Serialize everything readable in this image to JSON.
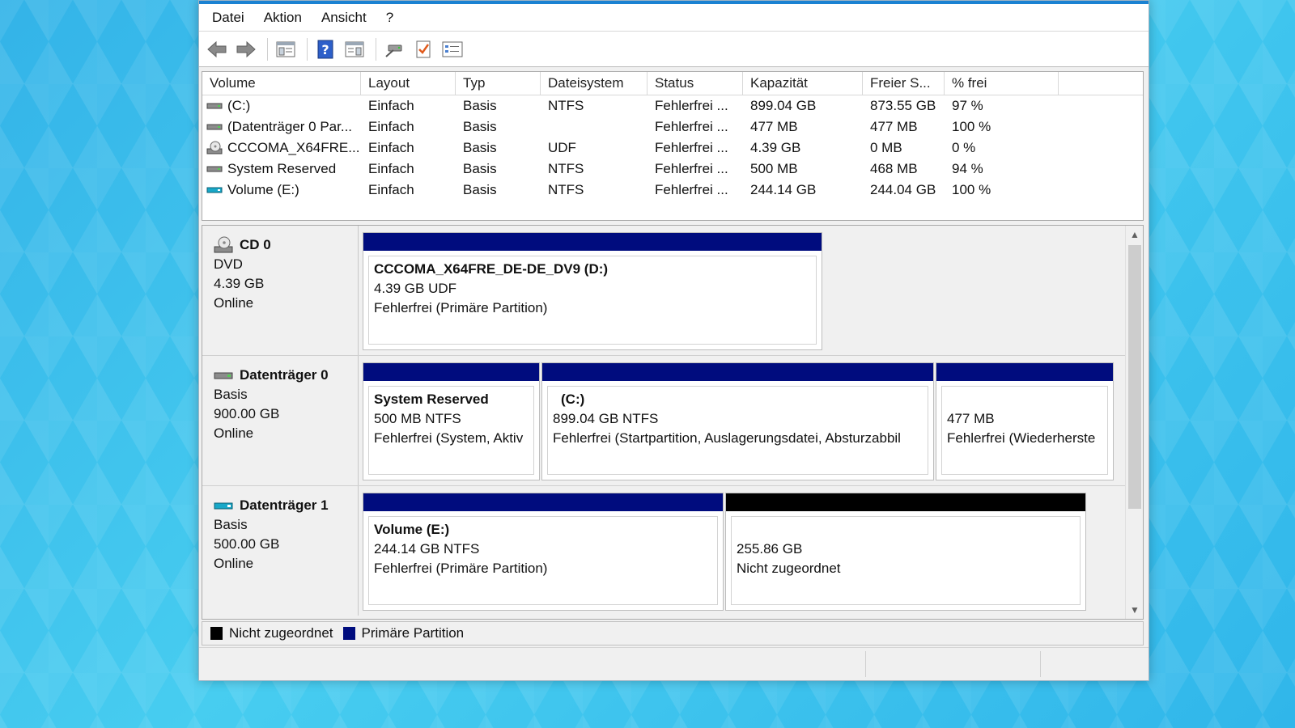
{
  "menu": [
    "Datei",
    "Aktion",
    "Ansicht",
    "?"
  ],
  "toolbar": {
    "icons": [
      "back-arrow-icon",
      "forward-arrow-icon",
      "console-tree-icon",
      "help-icon",
      "action-pane-icon",
      "connect-disk-icon",
      "check-properties-icon",
      "list-view-icon"
    ]
  },
  "volume_list": {
    "columns": [
      "Volume",
      "Layout",
      "Typ",
      "Dateisystem",
      "Status",
      "Kapazität",
      "Freier S...",
      "% frei"
    ],
    "rows": [
      {
        "volume": "(C:)",
        "icon": "drive-icon",
        "layout": "Einfach",
        "typ": "Basis",
        "fs": "NTFS",
        "status": "Fehlerfrei ...",
        "cap": "899.04 GB",
        "free": "873.55 GB",
        "pct": "97 %"
      },
      {
        "volume": "(Datenträger 0 Par...",
        "icon": "drive-icon",
        "layout": "Einfach",
        "typ": "Basis",
        "fs": "",
        "status": "Fehlerfrei ...",
        "cap": "477 MB",
        "free": "477 MB",
        "pct": "100 %"
      },
      {
        "volume": "CCCOMA_X64FRE...",
        "icon": "dvd-icon",
        "layout": "Einfach",
        "typ": "Basis",
        "fs": "UDF",
        "status": "Fehlerfrei ...",
        "cap": "4.39 GB",
        "free": "0 MB",
        "pct": "0 %"
      },
      {
        "volume": "System Reserved",
        "icon": "drive-icon",
        "layout": "Einfach",
        "typ": "Basis",
        "fs": "NTFS",
        "status": "Fehlerfrei ...",
        "cap": "500 MB",
        "free": "468 MB",
        "pct": "94 %"
      },
      {
        "volume": "Volume (E:)",
        "icon": "usb-drive-icon",
        "layout": "Einfach",
        "typ": "Basis",
        "fs": "NTFS",
        "status": "Fehlerfrei ...",
        "cap": "244.14 GB",
        "free": "244.04 GB",
        "pct": "100 %"
      }
    ]
  },
  "disks": [
    {
      "name": "CD 0",
      "type": "DVD",
      "size": "4.39 GB",
      "state": "Online",
      "icon": "dvd-icon",
      "partitions": [
        {
          "title": "CCCOMA_X64FRE_DE-DE_DV9  (D:)",
          "line2": "4.39 GB UDF",
          "line3": "Fehlerfrei (Primäre Partition)",
          "kind": "primary"
        }
      ]
    },
    {
      "name": "Datenträger 0",
      "type": "Basis",
      "size": "900.00 GB",
      "state": "Online",
      "icon": "drive-icon",
      "partitions": [
        {
          "title": "System Reserved",
          "line2": "500 MB NTFS",
          "line3": "Fehlerfrei (System, Aktiv",
          "kind": "primary"
        },
        {
          "title": "(C:)",
          "line2": "899.04 GB NTFS",
          "line3": "Fehlerfrei (Startpartition, Auslagerungsdatei, Absturzabbil",
          "kind": "primary"
        },
        {
          "title": "",
          "line2": "477 MB",
          "line3": "Fehlerfrei (Wiederherste",
          "kind": "primary"
        }
      ]
    },
    {
      "name": "Datenträger 1",
      "type": "Basis",
      "size": "500.00 GB",
      "state": "Online",
      "icon": "usb-drive-icon",
      "partitions": [
        {
          "title": "Volume  (E:)",
          "line2": "244.14 GB NTFS",
          "line3": "Fehlerfrei (Primäre Partition)",
          "kind": "primary"
        },
        {
          "title": "",
          "line2": "255.86 GB",
          "line3": "Nicht zugeordnet",
          "kind": "unallocated"
        }
      ]
    }
  ],
  "legend": [
    {
      "label": "Nicht zugeordnet",
      "color": "#000000"
    },
    {
      "label": "Primäre Partition",
      "color": "#000c7e"
    }
  ]
}
